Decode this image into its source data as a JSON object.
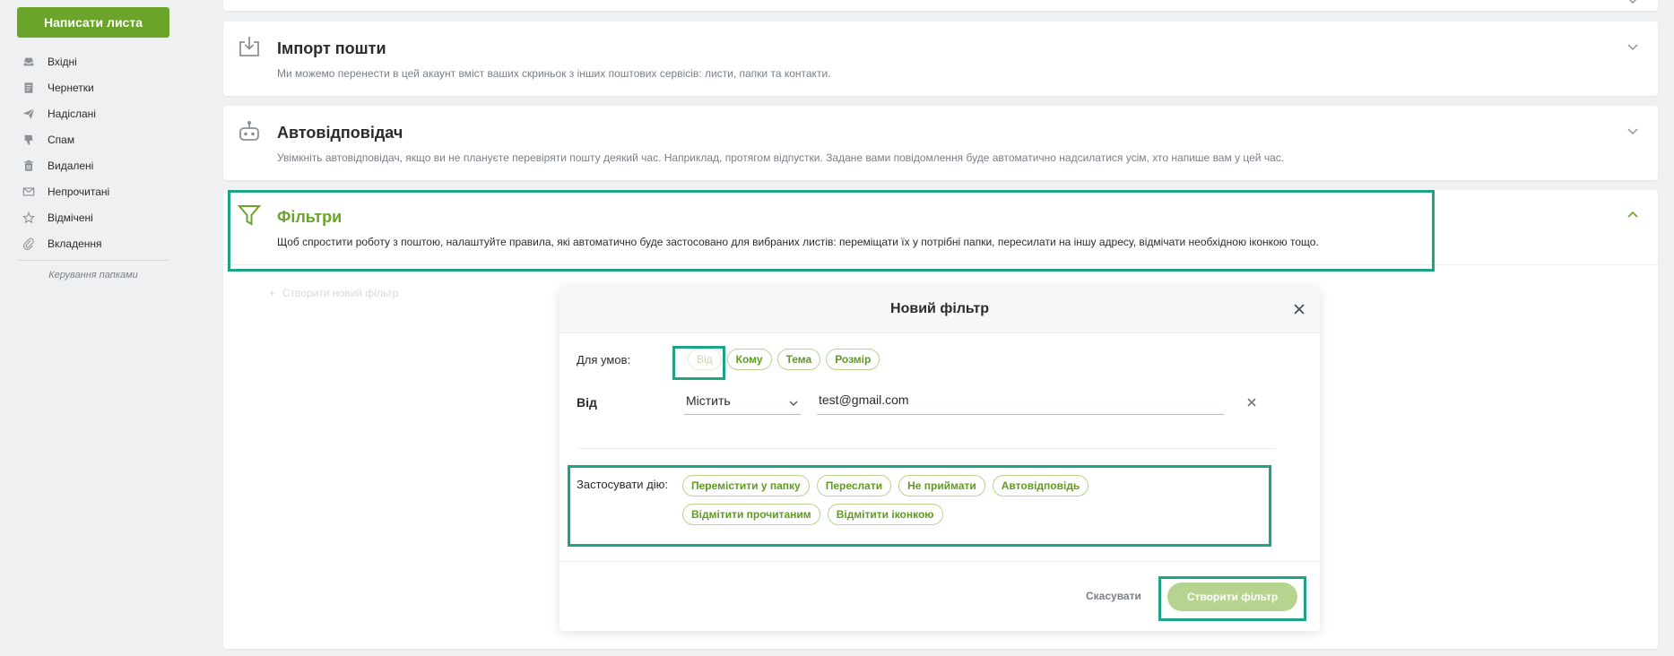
{
  "sidebar": {
    "compose_label": "Написати листа",
    "items": [
      {
        "label": "Вхідні",
        "icon": "inbox-icon"
      },
      {
        "label": "Чернетки",
        "icon": "drafts-icon"
      },
      {
        "label": "Надіслані",
        "icon": "sent-icon"
      },
      {
        "label": "Спам",
        "icon": "spam-icon"
      },
      {
        "label": "Видалені",
        "icon": "trash-icon"
      },
      {
        "label": "Непрочитані",
        "icon": "unread-icon"
      },
      {
        "label": "Відмічені",
        "icon": "star-icon"
      },
      {
        "label": "Вкладення",
        "icon": "attachment-icon"
      }
    ],
    "folders_link": "Керування папками"
  },
  "sections": {
    "import": {
      "title": "Імпорт пошти",
      "description": "Ми можемо перенести в цей акаунт вміст ваших скриньок з інших поштових сервісів: листи, папки та контакти.",
      "icon": "import-icon"
    },
    "autoreply": {
      "title": "Автовідповідач",
      "description": "Увімкніть автовідповідач, якщо ви не плануєте перевіряти пошту деякий час. Наприклад, протягом відпустки. Задане вами повідомлення буде автоматично надсилатися усім, хто напише вам у цей час.",
      "icon": "robot-icon"
    },
    "filters": {
      "title": "Фільтри",
      "description": "Щоб спростити роботу з поштою, налаштуйте правила, які автоматично буде застосовано для вибраних листів: переміщати їх у потрібні папки, пересилати на іншу адресу, відмічати необхідною іконкою тощо.",
      "icon": "filter-icon",
      "create_new_label": "Створити новий фільтр"
    }
  },
  "modal": {
    "title": "Новий фільтр",
    "conditions_label": "Для умов:",
    "condition_chips": [
      "Від",
      "Кому",
      "Тема",
      "Розмір"
    ],
    "row_field_label": "Від",
    "operator_value": "Містить",
    "value_input": "test@gmail.com",
    "action_label": "Застосувати дію:",
    "action_chips": [
      "Перемістити у папку",
      "Переслати",
      "Не приймати",
      "Автовідповідь",
      "Відмітити прочитаним",
      "Відмітити іконкою"
    ],
    "cancel_label": "Скасувати",
    "create_label": "Створити фільтр"
  },
  "colors": {
    "accent": "#6aa52a",
    "highlight": "#1fa387",
    "disabled_button": "#b6d38f"
  }
}
